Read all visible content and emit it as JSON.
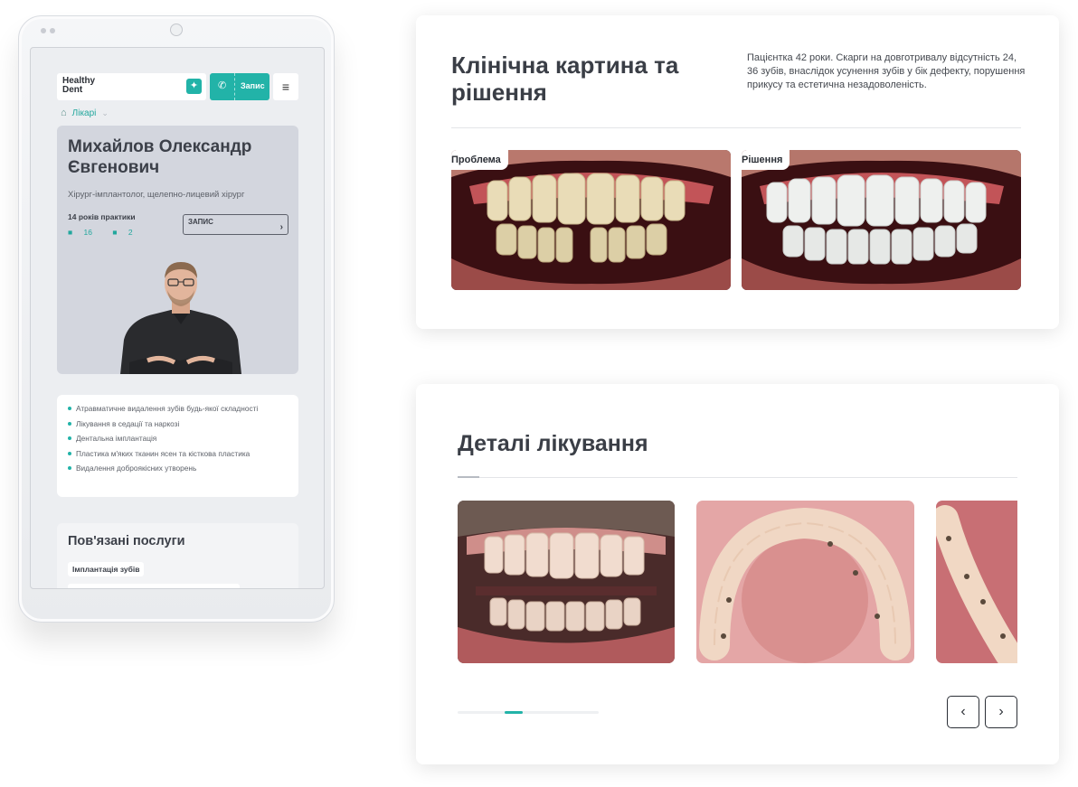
{
  "mobile": {
    "logo": "Healthy Dent",
    "book_label": "Запис",
    "breadcrumb": "Лікарі",
    "doctor": {
      "name": "Михайлов Олександр Євгенович",
      "specialty": "Хірург-імплантолог, щелепно-лицевий хірург",
      "experience": "14 років практики",
      "reviews": "16",
      "cases": "2",
      "book_button": "ЗАПИС"
    },
    "services": [
      "Атравматичне видалення зубів будь-якої складності",
      "Лікування в седації та наркозі",
      "Дентальна імплантація",
      "Пластика м'яких тканин ясен та кісткова пластика",
      "Видалення доброякісних утворень"
    ],
    "related_title": "Пов'язані послуги",
    "related_tag": "Імплантація зубів"
  },
  "clinical": {
    "title": "Клінічна картина та рішення",
    "description": "Пацієнтка 42 роки. Скарги на довготривалу відсутність 24, 36 зубів, внаслідок усунення зубів у бік дефекту, порушення прикусу та естетична незадоволеність.",
    "problem_label": "Проблема",
    "solution_label": "Рішення"
  },
  "treatment": {
    "title": "Деталі лікування",
    "progress": 0.25,
    "prev_icon": "‹",
    "next_icon": "›"
  },
  "colors": {
    "accent": "#22b3a8",
    "text": "#3a3e46"
  }
}
